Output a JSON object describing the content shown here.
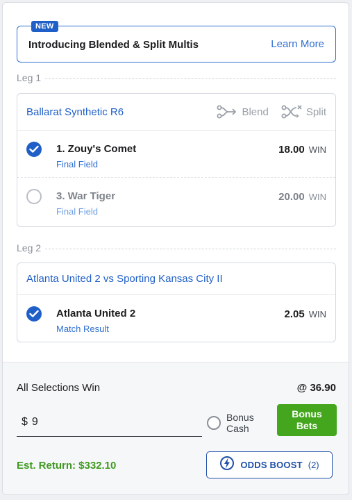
{
  "promo": {
    "badge": "NEW",
    "text": "Introducing Blended & Split Multis",
    "link": "Learn More"
  },
  "legs": [
    {
      "heading": "Leg 1",
      "event": "Ballarat Synthetic R6",
      "blend_label": "Blend",
      "split_label": "Split",
      "selections": [
        {
          "runner": "1. Zouy's Comet",
          "market": "Final Field",
          "odds": "18.00",
          "type": "WIN",
          "checked": true
        },
        {
          "runner": "3. War Tiger",
          "market": "Final Field",
          "odds": "20.00",
          "type": "WIN",
          "checked": false
        }
      ]
    },
    {
      "heading": "Leg 2",
      "event": "Atlanta United 2 vs Sporting Kansas City II",
      "selections": [
        {
          "runner": "Atlanta United 2",
          "market": "Match Result",
          "odds": "2.05",
          "type": "WIN",
          "checked": true
        }
      ]
    }
  ],
  "betslip": {
    "all_selections_label": "All Selections Win",
    "total_odds": "@ 36.90",
    "currency": "$",
    "stake": "9",
    "bonus_cash_label_1": "Bonus",
    "bonus_cash_label_2": "Cash",
    "bonus_bets_label_1": "Bonus",
    "bonus_bets_label_2": "Bets",
    "est_return": "Est. Return: $332.10",
    "odds_boost_label": "ODDS BOOST",
    "odds_boost_count": "(2)"
  },
  "colors": {
    "brand_blue": "#1f5fc7",
    "link_blue": "#2f6fd1",
    "bonus_green": "#43a61c",
    "return_green": "#3e9a1e"
  },
  "icons": [
    "blend-icon",
    "split-icon",
    "check-icon",
    "odds-boost-icon"
  ]
}
